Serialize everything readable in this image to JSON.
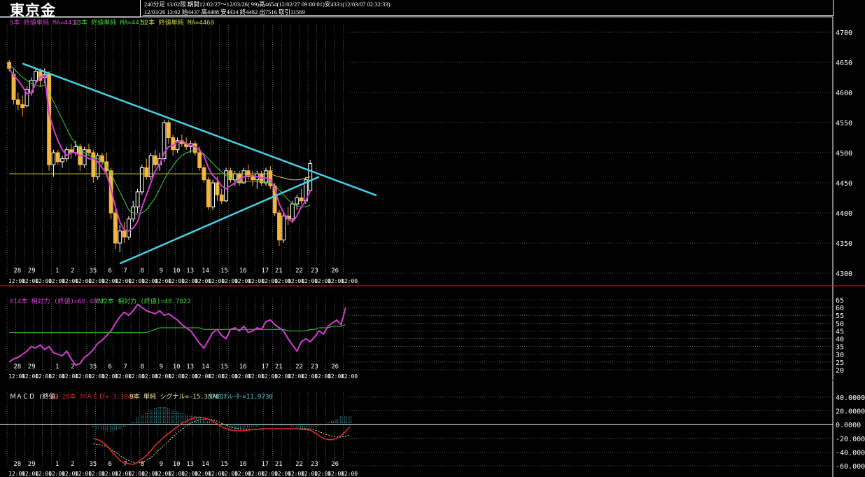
{
  "header": {
    "title": "東京金",
    "info_line1": "240分足 13/02限   期間12/02/27〜12/03/26( 99)高4654(12/02/27 09:00:01)安4331(12/03/07 02:32:33)",
    "info_line2": "12/03/26 13:02 始4437 高4488 安4434 終4482 出7516 取引11569"
  },
  "colors": {
    "background": "#000000",
    "bullish": "#ffffff",
    "bearish": "#f5b43c",
    "ma5": "#d23cd2",
    "ma13": "#3cd23c",
    "ma52": "#d2d23c",
    "trendline": "#46d2e6",
    "macd": "#e12828",
    "signal": "#e6e6aa",
    "oscillator": "#50d2dc"
  },
  "main_legend": [
    {
      "text": "5本 終値単純 MA=4437",
      "color": "#d23cd2"
    },
    {
      "text": "13本 終値単純 MA=4413",
      "color": "#3cd23c"
    },
    {
      "text": "52本 終値単純 MA=4460",
      "color": "#d2d23c"
    }
  ],
  "rsi_legend": [
    {
      "text": "014本 相対力 (終値)=60.4877",
      "color": "#d23cd2"
    },
    {
      "text": "042本 相対力 (終値)=48.7822",
      "color": "#3cd23c"
    }
  ],
  "macd_legend": [
    {
      "text": "ＭＡＣＤ (終値)",
      "color": "#ffffff"
    },
    {
      "text": "12-26本 ＭＡＣＤ=-3.3840",
      "color": "#e12828"
    },
    {
      "text": "9本 単純 シグナル=-15.3570",
      "color": "#e6e6aa"
    },
    {
      "text": "MACDｵｼﾚｰﾀｰ=11.9730",
      "color": "#50d2dc"
    }
  ],
  "date_labels": [
    "28",
    "29",
    "1",
    "2",
    "35",
    "6",
    "7",
    "8",
    "9",
    "10",
    "13",
    "14",
    "15",
    "16",
    "17",
    "21",
    "22",
    "23",
    "26"
  ],
  "bottom_label": "12:00",
  "chart_data": [
    {
      "type": "candlestick",
      "title": "東京金",
      "ylim": [
        4300,
        4700
      ],
      "yticks": [
        4300,
        4350,
        4400,
        4450,
        4500,
        4550,
        4600,
        4650,
        4700
      ],
      "ohlc": [
        [
          4650,
          4654,
          4635,
          4640
        ],
        [
          4630,
          4640,
          4580,
          4588
        ],
        [
          4588,
          4600,
          4570,
          4580
        ],
        [
          4580,
          4595,
          4560,
          4575
        ],
        [
          4578,
          4610,
          4575,
          4605
        ],
        [
          4600,
          4625,
          4595,
          4620
        ],
        [
          4620,
          4640,
          4615,
          4635
        ],
        [
          4635,
          4640,
          4610,
          4620
        ],
        [
          4625,
          4640,
          4615,
          4630
        ],
        [
          4630,
          4635,
          4470,
          4480
        ],
        [
          4480,
          4505,
          4460,
          4500
        ],
        [
          4500,
          4505,
          4480,
          4485
        ],
        [
          4485,
          4495,
          4475,
          4490
        ],
        [
          4490,
          4510,
          4485,
          4505
        ],
        [
          4505,
          4515,
          4490,
          4500
        ],
        [
          4500,
          4520,
          4495,
          4510
        ],
        [
          4510,
          4515,
          4470,
          4480
        ],
        [
          4480,
          4510,
          4475,
          4505
        ],
        [
          4505,
          4515,
          4495,
          4500
        ],
        [
          4500,
          4505,
          4450,
          4460
        ],
        [
          4460,
          4500,
          4455,
          4495
        ],
        [
          4495,
          4500,
          4480,
          4485
        ],
        [
          4485,
          4500,
          4460,
          4470
        ],
        [
          4470,
          4475,
          4390,
          4400
        ],
        [
          4400,
          4410,
          4340,
          4350
        ],
        [
          4350,
          4380,
          4335,
          4370
        ],
        [
          4370,
          4385,
          4350,
          4360
        ],
        [
          4360,
          4395,
          4355,
          4390
        ],
        [
          4390,
          4420,
          4385,
          4410
        ],
        [
          4410,
          4440,
          4400,
          4435
        ],
        [
          4435,
          4480,
          4430,
          4475
        ],
        [
          4475,
          4490,
          4455,
          4460
        ],
        [
          4460,
          4500,
          4455,
          4495
        ],
        [
          4495,
          4505,
          4475,
          4480
        ],
        [
          4480,
          4500,
          4470,
          4490
        ],
        [
          4490,
          4555,
          4485,
          4550
        ],
        [
          4550,
          4555,
          4515,
          4525
        ],
        [
          4525,
          4530,
          4495,
          4505
        ],
        [
          4505,
          4525,
          4500,
          4520
        ],
        [
          4520,
          4530,
          4510,
          4515
        ],
        [
          4515,
          4525,
          4505,
          4510
        ],
        [
          4510,
          4520,
          4500,
          4515
        ],
        [
          4515,
          4520,
          4495,
          4500
        ],
        [
          4500,
          4510,
          4470,
          4475
        ],
        [
          4475,
          4480,
          4450,
          4455
        ],
        [
          4455,
          4460,
          4405,
          4410
        ],
        [
          4410,
          4455,
          4405,
          4450
        ],
        [
          4450,
          4460,
          4420,
          4430
        ],
        [
          4430,
          4440,
          4415,
          4420
        ],
        [
          4420,
          4475,
          4418,
          4470
        ],
        [
          4470,
          4475,
          4450,
          4455
        ],
        [
          4455,
          4470,
          4445,
          4465
        ],
        [
          4465,
          4470,
          4445,
          4450
        ],
        [
          4450,
          4475,
          4448,
          4470
        ],
        [
          4470,
          4480,
          4455,
          4460
        ],
        [
          4460,
          4470,
          4445,
          4455
        ],
        [
          4455,
          4470,
          4440,
          4465
        ],
        [
          4465,
          4470,
          4445,
          4450
        ],
        [
          4450,
          4475,
          4445,
          4470
        ],
        [
          4470,
          4478,
          4440,
          4445
        ],
        [
          4445,
          4450,
          4395,
          4400
        ],
        [
          4400,
          4405,
          4345,
          4355
        ],
        [
          4355,
          4400,
          4350,
          4395
        ],
        [
          4395,
          4410,
          4380,
          4390
        ],
        [
          4390,
          4420,
          4385,
          4415
        ],
        [
          4415,
          4430,
          4405,
          4425
        ],
        [
          4425,
          4440,
          4415,
          4420
        ],
        [
          4420,
          4460,
          4415,
          4455
        ],
        [
          4437,
          4488,
          4434,
          4482
        ]
      ],
      "ma5": [
        4640,
        4628,
        4620,
        4610,
        4598,
        4600,
        4615,
        4625,
        4628,
        4565,
        4540,
        4520,
        4505,
        4495,
        4500,
        4500,
        4495,
        4495,
        4490,
        4490,
        4485,
        4475,
        4465,
        4440,
        4410,
        4385,
        4372,
        4370,
        4375,
        4385,
        4410,
        4430,
        4450,
        4470,
        4480,
        4500,
        4510,
        4512,
        4518,
        4520,
        4515,
        4512,
        4510,
        4505,
        4495,
        4475,
        4462,
        4455,
        4445,
        4440,
        4445,
        4450,
        4455,
        4460,
        4462,
        4462,
        4460,
        4458,
        4458,
        4455,
        4440,
        4415,
        4400,
        4390,
        4385,
        4395,
        4410,
        4420,
        4437
      ],
      "ma13": [
        4645,
        4640,
        4632,
        4625,
        4620,
        4615,
        4612,
        4610,
        4612,
        4600,
        4585,
        4570,
        4555,
        4540,
        4525,
        4515,
        4505,
        4500,
        4495,
        4492,
        4490,
        4485,
        4478,
        4465,
        4450,
        4435,
        4420,
        4405,
        4400,
        4398,
        4400,
        4405,
        4415,
        4425,
        4440,
        4455,
        4468,
        4478,
        4488,
        4495,
        4500,
        4502,
        4505,
        4502,
        4498,
        4490,
        4482,
        4475,
        4468,
        4462,
        4458,
        4455,
        4452,
        4452,
        4452,
        4452,
        4452,
        4452,
        4452,
        4450,
        4446,
        4438,
        4430,
        4422,
        4415,
        4412,
        4410,
        4410,
        4413
      ],
      "ma52": [
        4465,
        4465,
        4465,
        4465,
        4465,
        4465,
        4465,
        4465,
        4465,
        4465,
        4465,
        4465,
        4465,
        4465,
        4465,
        4465,
        4465,
        4465,
        4465,
        4465,
        4465,
        4465,
        4465,
        4465,
        4465,
        4465,
        4465,
        4465,
        4465,
        4465,
        4465,
        4465,
        4465,
        4465,
        4465,
        4465,
        4465,
        4465,
        4465,
        4465,
        4465,
        4465,
        4465,
        4465,
        4465,
        4465,
        4465,
        4465,
        4465,
        4465,
        4465,
        4465,
        4465,
        4465,
        4465,
        4465,
        4465,
        4465,
        4465,
        4465,
        4462,
        4460,
        4458,
        4456,
        4455,
        4455,
        4456,
        4458,
        4460
      ],
      "trendlines": [
        {
          "from": [
            3,
            4648
          ],
          "to": [
            83,
            4429
          ]
        },
        {
          "from": [
            25,
            4316
          ],
          "to": [
            70,
            4460
          ]
        }
      ]
    },
    {
      "type": "line",
      "title": "相対力",
      "ylim": [
        20,
        65
      ],
      "yticks": [
        20,
        25,
        30,
        35,
        40,
        45,
        50,
        55,
        60,
        65
      ],
      "series": [
        {
          "name": "014本 相対力 (終値)",
          "values": [
            25,
            27,
            28,
            30,
            32,
            35,
            34,
            36,
            33,
            35,
            31,
            30,
            29,
            32,
            27,
            23,
            24,
            28,
            30,
            33,
            37,
            39,
            42,
            45,
            50,
            54,
            57,
            55,
            58,
            62,
            60,
            58,
            57,
            56,
            58,
            55,
            56,
            54,
            52,
            49,
            47,
            45,
            41,
            37,
            34,
            39,
            44,
            46,
            42,
            40,
            46,
            47,
            45,
            48,
            44,
            45,
            47,
            46,
            51,
            52,
            49,
            47,
            45,
            40,
            36,
            32,
            38,
            40,
            38,
            41,
            45,
            43,
            48,
            50,
            52,
            49,
            60
          ]
        },
        {
          "name": "042本 相対力 (終値)",
          "values": [
            44,
            44,
            44,
            44,
            44,
            44,
            44,
            44,
            44,
            44,
            44,
            44,
            44,
            44,
            44,
            44,
            44,
            44,
            44,
            44,
            44,
            44,
            44,
            44,
            44,
            44,
            44,
            44,
            44,
            44,
            44,
            44,
            45,
            46,
            47,
            47,
            47,
            47,
            47,
            47,
            47,
            47,
            47,
            47,
            46,
            46,
            46,
            46,
            46,
            46,
            46,
            46,
            46,
            46,
            46,
            46,
            46,
            46,
            46,
            46,
            46,
            46,
            46,
            45,
            45,
            45,
            45,
            45,
            46,
            46,
            47,
            47,
            47,
            48,
            48,
            48,
            49
          ]
        }
      ]
    },
    {
      "type": "bar",
      "title": "ＭＡＣＤ (終値)",
      "ylim": [
        -60,
        40
      ],
      "yticks": [
        -60,
        -40,
        -20,
        0,
        20,
        40
      ],
      "ytick_labels": [
        "-60.0000",
        "-40.0000",
        "-20.0000",
        "0.0000",
        "20.0000",
        "40.0000"
      ],
      "series": [
        {
          "name": "ＭＡＣＤ",
          "values": [
            0,
            0,
            0,
            0,
            0,
            0,
            0,
            0,
            0,
            0,
            0,
            0,
            0,
            0,
            0,
            0,
            0,
            0,
            0,
            -20,
            -22,
            -25,
            -30,
            -38,
            -45,
            -52,
            -56,
            -57,
            -58,
            -55,
            -50,
            -45,
            -38,
            -30,
            -24,
            -18,
            -13,
            -8,
            -3,
            2,
            5,
            8,
            10,
            11,
            10,
            8,
            5,
            1,
            -3,
            -6,
            -8,
            -9,
            -9,
            -9,
            -8,
            -7,
            -7,
            -6,
            -6,
            -6,
            -6,
            -6,
            -6,
            -6,
            -6,
            -6,
            -7,
            -7,
            -8,
            -12,
            -16,
            -20,
            -22,
            -22,
            -20,
            -16,
            -10,
            -3
          ]
        },
        {
          "name": "シグナル",
          "values": [
            0,
            0,
            0,
            0,
            0,
            0,
            0,
            0,
            0,
            0,
            0,
            0,
            0,
            0,
            0,
            0,
            0,
            0,
            0,
            -28,
            -29,
            -30,
            -32,
            -36,
            -40,
            -45,
            -49,
            -52,
            -55,
            -56,
            -55,
            -52,
            -48,
            -42,
            -36,
            -30,
            -24,
            -18,
            -12,
            -7,
            -2,
            2,
            5,
            7,
            8,
            8,
            7,
            5,
            2,
            -1,
            -3,
            -5,
            -6,
            -7,
            -7,
            -7,
            -7,
            -7,
            -6,
            -6,
            -6,
            -6,
            -6,
            -6,
            -6,
            -6,
            -6,
            -6,
            -7,
            -8,
            -10,
            -13,
            -15,
            -17,
            -18,
            -18,
            -17,
            -15
          ]
        },
        {
          "name": "MACDｵｼﾚｰﾀｰ",
          "values": [
            0,
            0,
            0,
            0,
            0,
            0,
            0,
            0,
            0,
            0,
            0,
            0,
            0,
            0,
            0,
            0,
            0,
            0,
            0,
            -5,
            -7,
            -9,
            -10,
            -10,
            -9,
            -7,
            -4,
            -1,
            4,
            10,
            15,
            18,
            22,
            24,
            26,
            26,
            24,
            22,
            20,
            18,
            16,
            14,
            12,
            10,
            8,
            6,
            4,
            2,
            -2,
            -5,
            -7,
            -8,
            -7,
            -6,
            -5,
            -4,
            -3,
            -2,
            -1,
            -1,
            -1,
            -1,
            -1,
            -2,
            -3,
            -5,
            -7,
            -8,
            -6,
            -4,
            -2,
            0,
            3,
            6,
            9,
            12,
            12,
            12
          ]
        }
      ]
    }
  ]
}
